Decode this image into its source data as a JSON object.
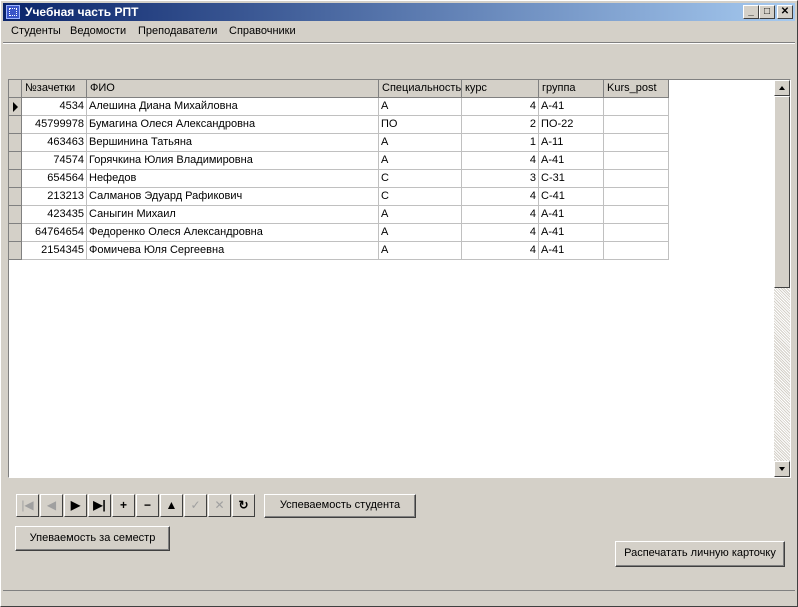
{
  "window": {
    "title": "Учебная часть РПТ",
    "minimize_glyph": "_",
    "maximize_glyph": "□",
    "close_glyph": "✕"
  },
  "menu": [
    {
      "label": "Студенты"
    },
    {
      "label": "Ведомости"
    },
    {
      "label": "Преподаватели"
    },
    {
      "label": "Справочники"
    }
  ],
  "grid": {
    "columns": [
      "№зачетки",
      "ФИО",
      "Специальность",
      "курс",
      "группа",
      "Kurs_post"
    ],
    "rows": [
      [
        "4534",
        "Алешина Диана Михайловна",
        "А",
        "4",
        "А-41",
        ""
      ],
      [
        "45799978",
        "Бумагина Олеся Александровна",
        "ПО",
        "2",
        "ПО-22",
        ""
      ],
      [
        "463463",
        "Вершинина Татьяна",
        "А",
        "1",
        "А-11",
        ""
      ],
      [
        "74574",
        "Горячкина Юлия Владимировна",
        "А",
        "4",
        "А-41",
        ""
      ],
      [
        "654564",
        "Нефедов",
        "С",
        "3",
        "С-31",
        ""
      ],
      [
        "213213",
        "Салманов Эдуард Рафикович",
        "С",
        "4",
        "С-41",
        ""
      ],
      [
        "423435",
        "Саныгин Михаил",
        "А",
        "4",
        "А-41",
        ""
      ],
      [
        "64764654",
        "Федоренко Олеся Александровна",
        "А",
        "4",
        "А-41",
        ""
      ],
      [
        "2154345",
        "Фомичева Юля Сергеевна",
        "А",
        "4",
        "А-41",
        ""
      ]
    ],
    "current_row": 0
  },
  "navigator": [
    {
      "name": "nav-first-button",
      "glyph": "|◀",
      "enabled": false
    },
    {
      "name": "nav-prior-button",
      "glyph": "◀",
      "enabled": false
    },
    {
      "name": "nav-next-button",
      "glyph": "▶",
      "enabled": true
    },
    {
      "name": "nav-last-button",
      "glyph": "▶|",
      "enabled": true
    },
    {
      "name": "nav-insert-button",
      "glyph": "+",
      "enabled": true
    },
    {
      "name": "nav-delete-button",
      "glyph": "−",
      "enabled": true
    },
    {
      "name": "nav-edit-button",
      "glyph": "▲",
      "enabled": true
    },
    {
      "name": "nav-post-button",
      "glyph": "✓",
      "enabled": false
    },
    {
      "name": "nav-cancel-button",
      "glyph": "✕",
      "enabled": false
    },
    {
      "name": "nav-refresh-button",
      "glyph": "↻",
      "enabled": true
    }
  ],
  "buttons": {
    "student_progress": "Успеваемость студента",
    "semester_progress": "Упеваемость за семестр",
    "print_card": "Распечатать личную карточку"
  }
}
